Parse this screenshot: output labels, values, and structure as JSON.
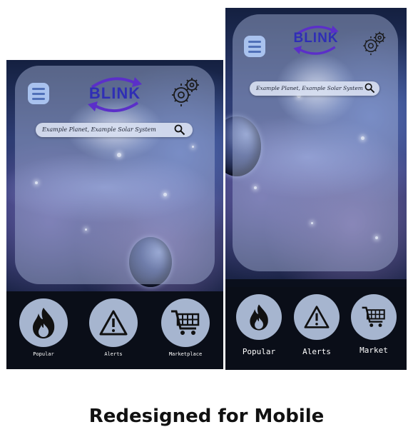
{
  "app": {
    "brand": "BLINK"
  },
  "search": {
    "placeholder": "Example Planet, Example Solar System"
  },
  "left_nav": {
    "popular_label": "Popular",
    "alerts_label": "Alerts",
    "marketplace_label": "Marketplace"
  },
  "right_nav": {
    "popular_label": "Popular",
    "alerts_label": "Alerts",
    "market_label": "Market"
  },
  "caption": "Redesigned for Mobile",
  "colors": {
    "brand": "#2f2eb5",
    "arrow": "#5b2fc9",
    "menu_button": "#a9c2ee",
    "nav_circle": "#a6b5cf",
    "nav_bar": "#0a0e18"
  },
  "icons": [
    "menu-icon",
    "gear-icon",
    "search-icon",
    "fire-icon",
    "warning-icon",
    "cart-icon"
  ]
}
